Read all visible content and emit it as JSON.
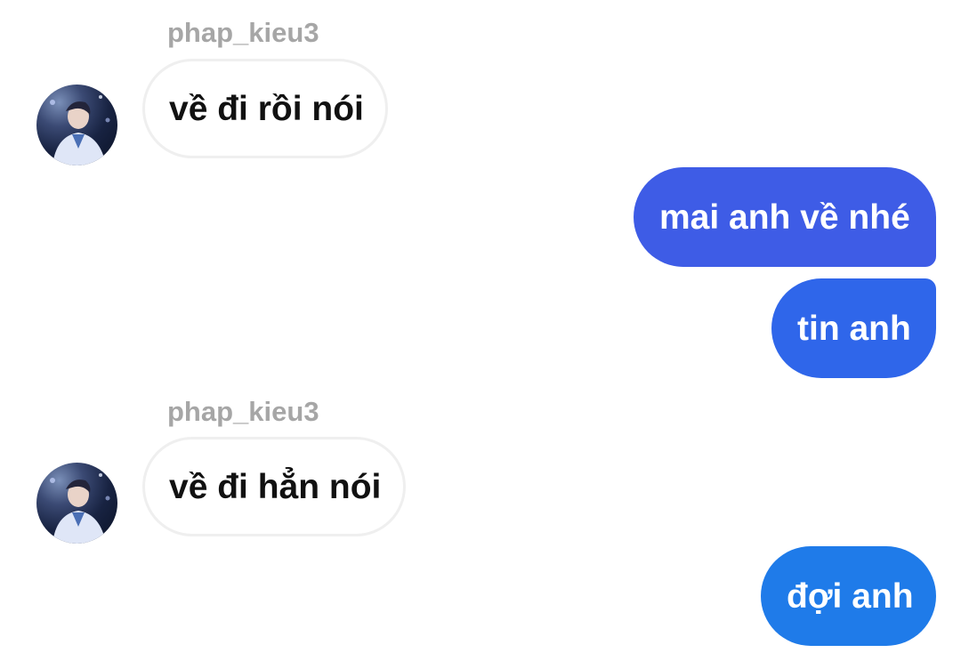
{
  "conversation": {
    "groups": [
      {
        "sender": "phap_kieu3",
        "message": "về đi rồi nói"
      },
      {
        "sent_messages": [
          "mai anh về nhé",
          "tin anh"
        ]
      },
      {
        "sender": "phap_kieu3",
        "message": "về đi hẳn nói"
      },
      {
        "sent_messages": [
          "đợi anh"
        ]
      }
    ]
  },
  "colors": {
    "outgoing_bubble_top": "#3e5ce6",
    "outgoing_bubble_mid": "#2f66ea",
    "outgoing_bubble_bottom": "#1f7be9",
    "incoming_bubble_border": "#efefef",
    "sender_name": "#a6a6a6"
  },
  "icons": {
    "avatar": "profile-photo-avatar"
  }
}
